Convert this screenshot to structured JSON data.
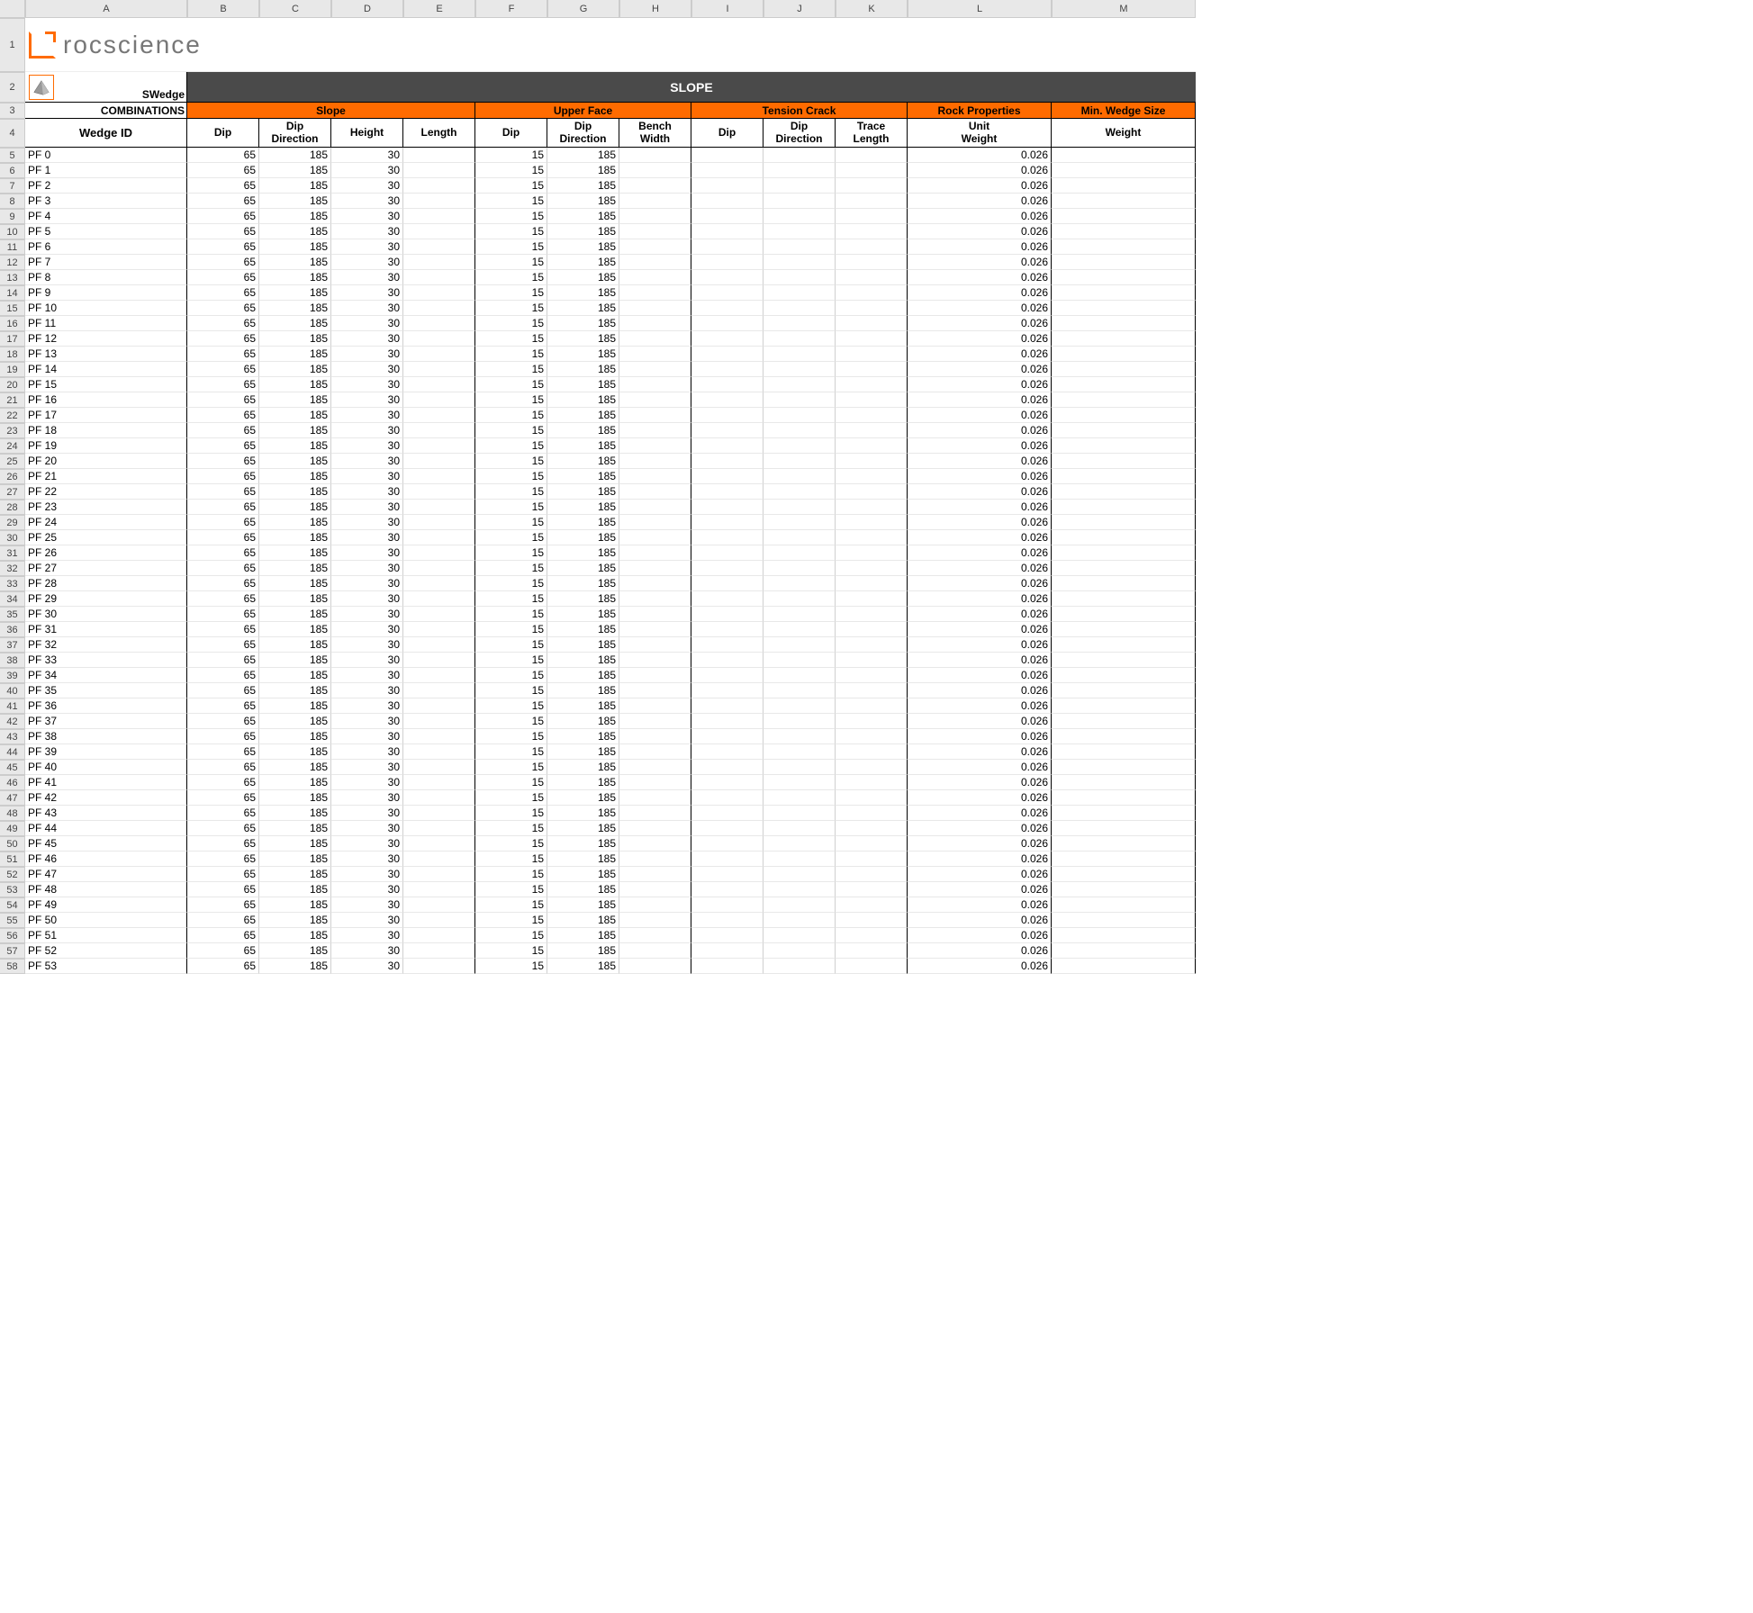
{
  "columns": [
    "A",
    "B",
    "C",
    "D",
    "E",
    "F",
    "G",
    "H",
    "I",
    "J",
    "K",
    "L",
    "M"
  ],
  "logo_text": "rocscience",
  "row2": {
    "product": "SWedge",
    "banner": "SLOPE"
  },
  "row3": {
    "label": "COMBINATIONS",
    "groups": [
      {
        "span": 4,
        "label": "Slope"
      },
      {
        "span": 3,
        "label": "Upper Face"
      },
      {
        "span": 3,
        "label": "Tension Crack"
      },
      {
        "span": 1,
        "label": "Rock Properties"
      },
      {
        "span": 1,
        "label": "Min. Wedge Size"
      }
    ]
  },
  "row4": {
    "wedge_id": "Wedge ID",
    "headers": [
      "Dip",
      "Dip Direction",
      "Height",
      "Length",
      "Dip",
      "Dip Direction",
      "Bench Width",
      "Dip",
      "Dip Direction",
      "Trace Length",
      "Unit Weight",
      "Weight"
    ]
  },
  "data_template": {
    "id_prefix": "PF ",
    "count": 54,
    "slope_dip": 65,
    "slope_dipdir": 185,
    "slope_height": 30,
    "slope_length": "",
    "uf_dip": 15,
    "uf_dipdir": 185,
    "bench_width": "",
    "tc_dip": "",
    "tc_dipdir": "",
    "tc_trace": "",
    "unit_weight": "0.026",
    "weight": ""
  },
  "first_data_excel_row": 5
}
